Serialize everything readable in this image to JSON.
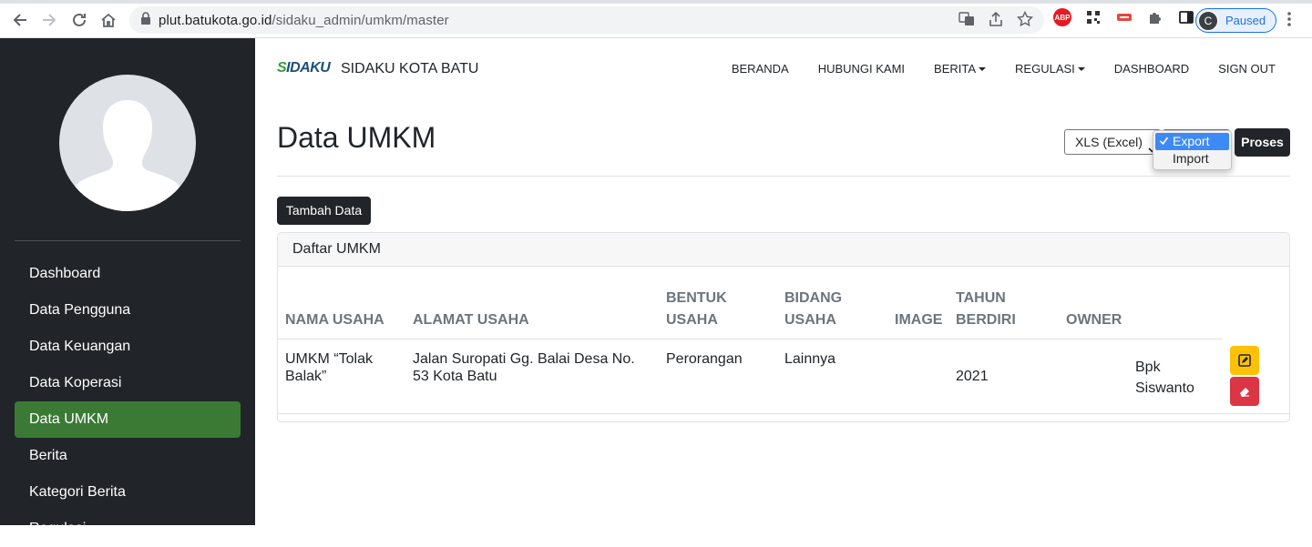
{
  "browser": {
    "url_host": "plut.batukota.go.id",
    "url_path": "/sidaku_admin/umkm/master",
    "profile_initial": "C",
    "profile_status": "Paused",
    "ext_abp": "ABP"
  },
  "brand": {
    "logo_prefix": "S",
    "logo_rest": "IDAKU",
    "name": "SIDAKU KOTA BATU"
  },
  "nav": {
    "beranda": "BERANDA",
    "hubungi": "HUBUNGI KAMI",
    "berita": "BERITA",
    "regulasi": "REGULASI",
    "dashboard": "DASHBOARD",
    "signout": "SIGN OUT"
  },
  "sidebar": {
    "items": [
      {
        "label": "Dashboard"
      },
      {
        "label": "Data Pengguna"
      },
      {
        "label": "Data Keuangan"
      },
      {
        "label": "Data Koperasi"
      },
      {
        "label": "Data UMKM"
      },
      {
        "label": "Berita"
      },
      {
        "label": "Kategori Berita"
      },
      {
        "label": "Regulasi"
      }
    ],
    "active_index": 4
  },
  "main": {
    "title": "Data UMKM",
    "format_select": "XLS (Excel)",
    "action_options": [
      "Export",
      "Import"
    ],
    "action_selected": "Export",
    "proses_label": "Proses",
    "add_label": "Tambah Data"
  },
  "table": {
    "card_title": "Daftar UMKM",
    "headers": {
      "nama_1": "NAMA USAHA",
      "alamat_1": "ALAMAT USAHA",
      "bentuk_1": "BENTUK",
      "bentuk_2": "USAHA",
      "bidang_1": "BIDANG",
      "bidang_2": "USAHA",
      "image": "IMAGE",
      "tahun_1": "TAHUN",
      "tahun_2": "BERDIRI",
      "owner": "OWNER"
    },
    "rows": [
      {
        "nama_1": "UMKM “Tolak",
        "nama_2": "Balak”",
        "alamat_1": "Jalan Suropati Gg. Balai Desa No.",
        "alamat_2": "53 Kota Batu",
        "bentuk": "Perorangan",
        "bidang": "Lainnya",
        "tahun": "2021",
        "owner_1": "Bpk",
        "owner_2": "Siswanto"
      }
    ]
  },
  "colors": {
    "sidebar_bg": "#212529",
    "active_item": "#3b7a35",
    "edit_button": "#ffc107",
    "delete_button": "#dc3545"
  }
}
